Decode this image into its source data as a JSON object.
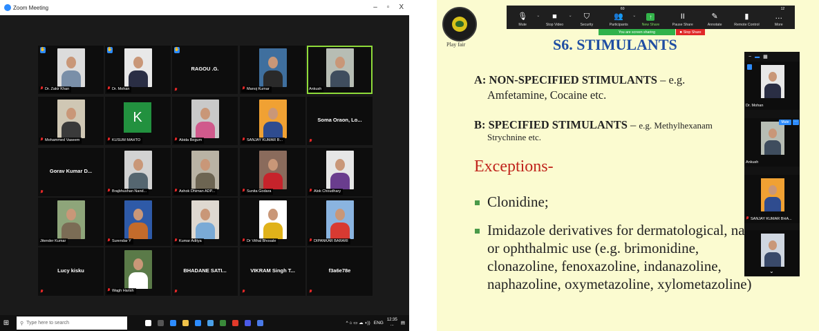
{
  "window": {
    "title": "Zoom Meeting",
    "minimize": "–",
    "restore": "▫",
    "close": "X"
  },
  "gallery": [
    {
      "name": "Dr. Zakir Khan",
      "hand": true,
      "mic": true,
      "photo": {
        "bg": "#dcdcdc",
        "shirt": "#7a8fa8"
      }
    },
    {
      "name": "Dr. Mohan",
      "hand": true,
      "mic": true,
      "photo": {
        "bg": "#e8e8e8",
        "shirt": "#2a2e44"
      }
    },
    {
      "name": "RAGOU .G.",
      "hand": true,
      "mic": true,
      "bigname": true
    },
    {
      "name": "Manoj Kumar",
      "mic": true,
      "photo": {
        "bg": "#3f6f9e",
        "shirt": "#2a2a2a"
      }
    },
    {
      "name": "Ankush",
      "speaking": true,
      "photo": {
        "bg": "#b7bdb4",
        "shirt": "#3f4d5e"
      }
    },
    {
      "name": "Mohammed Vaseem",
      "mic": true,
      "photo": {
        "bg": "#cfc7b4",
        "shirt": "#3a3a3a"
      }
    },
    {
      "name": "KUSUM MAHTO",
      "mic": true,
      "avatar": "K"
    },
    {
      "name": "Abida Begum",
      "mic": true,
      "photo": {
        "bg": "#c9c9c9",
        "shirt": "#d05a8c"
      }
    },
    {
      "name": "SANJAY KUMAR B...",
      "mic": true,
      "photo": {
        "bg": "#f0a133",
        "shirt": "#2f4c8f"
      }
    },
    {
      "name": "Soma Oraon, Lo...",
      "mic": true,
      "bigname": true
    },
    {
      "name": "Gorav Kumar D...",
      "mic": true,
      "bigname": true
    },
    {
      "name": "Brajbhushan Nand...",
      "mic": true,
      "photo": {
        "bg": "#d2d2d2",
        "shirt": "#556670"
      }
    },
    {
      "name": "Ashok Dhiman ADP...",
      "mic": true,
      "photo": {
        "bg": "#b9b3a4",
        "shirt": "#6d6552"
      }
    },
    {
      "name": "Sunita Godara",
      "mic": true,
      "photo": {
        "bg": "#8a6b5c",
        "shirt": "#c6232b"
      }
    },
    {
      "name": "Alok Choudhary",
      "mic": true,
      "photo": {
        "bg": "#e6e6e6",
        "shirt": "#6a3d8e"
      }
    },
    {
      "name": "Jitender Kumar",
      "photo": {
        "bg": "#8ea57a",
        "shirt": "#7b6c55"
      }
    },
    {
      "name": "Surendar Y",
      "mic": true,
      "photo": {
        "bg": "#2e5aa8",
        "shirt": "#c46b2b"
      }
    },
    {
      "name": "Kumar Aditya",
      "mic": true,
      "photo": {
        "bg": "#ded8d0",
        "shirt": "#7aaad6"
      }
    },
    {
      "name": "Dr Vithal Bhosale",
      "mic": true,
      "photo": {
        "bg": "#ffffff",
        "shirt": "#e0b21a"
      }
    },
    {
      "name": "DIPANKAR BARARI",
      "mic": true,
      "photo": {
        "bg": "#8ab4e0",
        "shirt": "#d83a32"
      }
    },
    {
      "name": "Lucy kisku",
      "mic": true,
      "bigname": true
    },
    {
      "name": "Wagh Harish",
      "mic": true,
      "photo": {
        "bg": "#5a7a48",
        "shirt": "#ffffff"
      }
    },
    {
      "name": "BHADANE SATI...",
      "mic": true,
      "bigname": true
    },
    {
      "name": "VIKRAM Singh T...",
      "mic": true,
      "bigname": true
    },
    {
      "name": "f3a6e78e",
      "mic": true,
      "bigname": true
    }
  ],
  "taskbar": {
    "search_placeholder": "Type here to search",
    "apps": [
      "#ffffff",
      "#555555",
      "#2d8cff",
      "#f0c24a",
      "#2d8cff",
      "#4aa0e8",
      "#3a8a3a",
      "#e03a2a",
      "#4a5ae8",
      "#4a7ae8"
    ],
    "tray_icons": "^ ⌂ ▭ ☁ ◖))",
    "language": "ENG",
    "time": "12:35",
    "date": "..."
  },
  "logo_caption": "Play fair",
  "zoom_toolbar": [
    {
      "icon": "mic-icon",
      "glyph": "🎙",
      "label": "Mute",
      "chevron": true
    },
    {
      "icon": "video-icon",
      "glyph": "■",
      "label": "Stop Video",
      "chevron": true
    },
    {
      "icon": "shield-icon",
      "glyph": "⛉",
      "label": "Security"
    },
    {
      "icon": "participants-icon",
      "glyph": "👥",
      "label": "Participants",
      "count": "60",
      "chevron": true
    },
    {
      "icon": "share-icon",
      "glyph": "↑",
      "label": "New Share",
      "green": true
    },
    {
      "icon": "pause-icon",
      "glyph": "II",
      "label": "Pause Share"
    },
    {
      "icon": "pen-icon",
      "glyph": "✎",
      "label": "Annotate"
    },
    {
      "icon": "mouse-icon",
      "glyph": "▮",
      "label": "Remote Control"
    },
    {
      "icon": "more-icon",
      "glyph": "…",
      "label": "More",
      "count": "12"
    }
  ],
  "share_status": "You are screen sharing",
  "stop_share": "Stop Share",
  "slide": {
    "title": "S6. STIMULANTS",
    "a_label": "A: NON-SPECIFIED STIMULANTS",
    "a_rest": " – e.g.",
    "a_line2": "Amfetamine, Cocaine etc.",
    "b_label": "B:  SPECIFIED  STIMULANTS",
    "b_rest": " – ",
    "b_rest_small": "e.g.  Methylhexanam",
    "b_line2": "Strychnine etc.",
    "exceptions": "Exceptions-",
    "bullet1": "Clonidine;",
    "bullet2_l1": "Imidazole derivatives for dermatological, nas",
    "bullet2_l2": "or ophthalmic use (e.g. brimonidine,",
    "bullet2_l3": "clonazoline, fenoxazoline, indanazoline,",
    "bullet2_l4": "naphazoline, oxymetazoline, xylometazoline)"
  },
  "strip": {
    "tiles": [
      {
        "name": "Dr. Mohan",
        "photo": {
          "bg": "#e8e8e8",
          "shirt": "#2a2e44"
        },
        "hand": true
      },
      {
        "name": "Ankush",
        "photo": {
          "bg": "#b7bdb4",
          "shirt": "#3f4d5e"
        },
        "speaking": true
      },
      {
        "name": "SANJAY KUMAR BHA...",
        "mic": true,
        "photo": {
          "bg": "#f0a133",
          "shirt": "#2f4c8f"
        }
      },
      {
        "name": "",
        "photo": {
          "bg": "#cfd6e0",
          "shirt": "#3a4a6a"
        }
      }
    ],
    "mute_label": "Mute",
    "more_label": "···"
  }
}
